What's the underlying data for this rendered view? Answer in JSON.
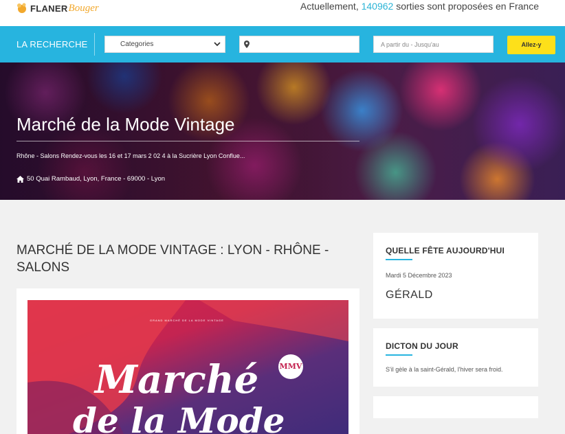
{
  "header": {
    "logo_part1": "FLANER",
    "logo_part2": "Bouger",
    "tagline_prefix": "Actuellement,",
    "tagline_count": "140962",
    "tagline_suffix": "sorties sont proposées en France"
  },
  "search": {
    "title": "LA RECHERCHE",
    "category_selected": "Categories",
    "place_value": "",
    "date_placeholder": "A partir du - Jusqu'au",
    "submit_label": "Allez-y"
  },
  "hero": {
    "title": "Marché de la Mode Vintage",
    "description": "Rhône - Salons Rendez-vous les 16 et 17 mars 2 02 4 à la Sucrière Lyon Conflue...",
    "address": "50 Quai Rambaud, Lyon, France - 69000 - Lyon"
  },
  "main": {
    "heading": "MARCHÉ DE LA MODE VINTAGE : LYON - RHÔNE - SALONS",
    "poster": {
      "line": "GRAND MARCHÉ DE LA MODE VINTAGE",
      "badge": "MMV",
      "word1": "Marché",
      "word2": "de la Mode"
    }
  },
  "sidebar": {
    "fete": {
      "title": "QUELLE FÊTE AUJOURD'HUI",
      "date": "Mardi 5 Décembre 2023",
      "name": "GÉRALD"
    },
    "dicton": {
      "title": "DICTON DU JOUR",
      "text": "S'il gèle à la saint-Gérald, l'hiver sera froid."
    }
  },
  "colors": {
    "accent": "#27b4df",
    "button": "#fde01a",
    "logo_orange": "#f2a82c"
  }
}
